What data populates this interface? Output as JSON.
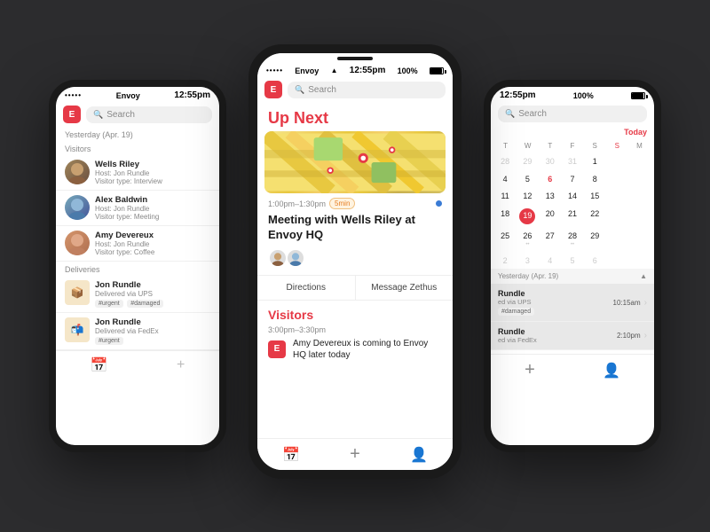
{
  "app": {
    "name": "Envoy",
    "logo_letter": "E"
  },
  "left_phone": {
    "status_bar": {
      "dots": "•••••",
      "carrier": "Envoy",
      "wifi": "WiFi",
      "time": "12:55pm"
    },
    "search_placeholder": "Search",
    "filter": "Yesterday (Apr. 19)",
    "sections": {
      "visitors_label": "Visitors",
      "deliveries_label": "Deliveries"
    },
    "visitors": [
      {
        "name": "Wells Riley",
        "host": "Host: Jon Rundle",
        "type": "Visitor type: Interview",
        "avatar_color": "#8B7355"
      },
      {
        "name": "Alex Baldwin",
        "host": "Host: Jon Rundle",
        "type": "Visitor type: Meeting",
        "avatar_color": "#5B8DB8"
      },
      {
        "name": "Amy Devereux",
        "host": "Host: Jon Rundle",
        "type": "Visitor type: Coffee",
        "avatar_color": "#C8956C"
      }
    ],
    "deliveries": [
      {
        "name": "Jon Rundle",
        "via": "Delivered via UPS",
        "tags": [
          "#urgent",
          "#damaged"
        ]
      },
      {
        "name": "Jon Rundle",
        "via": "Delivered via FedEx",
        "tags": [
          "#urgent"
        ]
      }
    ],
    "nav": {
      "calendar_icon": "📅",
      "plus_icon": "+"
    }
  },
  "center_phone": {
    "status_bar": {
      "dots": "•••••",
      "carrier": "Envoy",
      "wifi": "WiFi",
      "time": "12:55pm",
      "battery": "100%"
    },
    "search_placeholder": "Search",
    "up_next_label": "Up Next",
    "event": {
      "time": "1:00pm–1:30pm",
      "duration": "5min",
      "title": "Meeting with Wells Riley at Envoy HQ",
      "dot_color": "#3a7bd5"
    },
    "action_buttons": {
      "directions": "Directions",
      "message": "Message Zethus"
    },
    "visitors_section": {
      "title": "Visitors",
      "time": "3:00pm–3:30pm",
      "text": "Amy Devereux is coming to Envoy HQ later today"
    },
    "nav": {
      "calendar_icon": "📅",
      "plus_icon": "+",
      "profile_icon": "👤"
    }
  },
  "right_phone": {
    "status_bar": {
      "time": "12:55pm",
      "battery": "100%"
    },
    "search_placeholder": "Search",
    "today_label": "Today",
    "calendar": {
      "day_headers": [
        "T",
        "W",
        "T",
        "F",
        "S",
        "S",
        "M"
      ],
      "rows": [
        [
          "28",
          "29",
          "30",
          "31",
          "1",
          "",
          ""
        ],
        [
          "4",
          "5",
          "6",
          "7",
          "8",
          "",
          ""
        ],
        [
          "11",
          "12",
          "13",
          "14",
          "15",
          "",
          ""
        ],
        [
          "18",
          "19",
          "20",
          "21",
          "22",
          "",
          ""
        ],
        [
          "25",
          "26",
          "27",
          "28",
          "29",
          "",
          ""
        ],
        [
          "2",
          "3",
          "4",
          "5",
          "6",
          "",
          ""
        ]
      ],
      "today_cell": "19"
    },
    "section_label": "Yesterday (Apr. 19)",
    "list_items": [
      {
        "partial_name": "Rundle",
        "partial_detail": "ed via UPS",
        "tag": "#damaged",
        "time": "10:15am"
      },
      {
        "partial_name": "Rundle",
        "partial_detail": "ed via FedEx",
        "tag": "",
        "time": "2:10pm"
      }
    ],
    "nav": {
      "plus_icon": "+",
      "profile_icon": "👤"
    }
  }
}
